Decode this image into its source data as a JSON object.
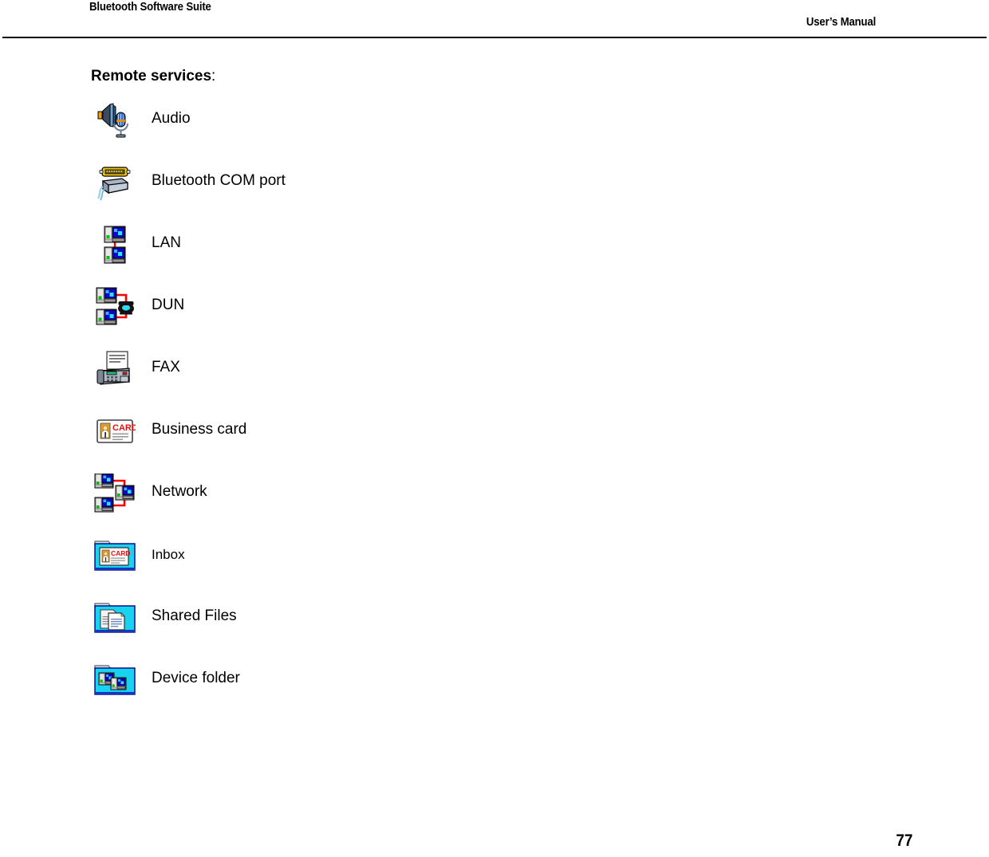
{
  "header": {
    "left_title": "Bluetooth Software Suite",
    "right_title": "User’s Manual"
  },
  "section": {
    "title": "Remote services",
    "title_suffix": ":"
  },
  "services": [
    {
      "icon": "audio-icon",
      "label": "Audio"
    },
    {
      "icon": "serial-port-icon",
      "label": "Bluetooth COM port"
    },
    {
      "icon": "lan-icon",
      "label": "LAN"
    },
    {
      "icon": "dialup-networking-icon",
      "label": "DUN"
    },
    {
      "icon": "fax-machine-icon",
      "label": "FAX"
    },
    {
      "icon": "business-card-icon",
      "label": "Business card"
    },
    {
      "icon": "network-icon",
      "label": "Network"
    },
    {
      "icon": "inbox-folder-icon",
      "label": "Inbox"
    },
    {
      "icon": "shared-files-folder-icon",
      "label": "Shared Files"
    },
    {
      "icon": "device-folder-icon",
      "label": "Device folder"
    }
  ],
  "footer": {
    "page_number": "77"
  },
  "colors": {
    "text": "#000000",
    "rule": "#000000",
    "folder_cyan": "#19D2F0",
    "monitor_blue": "#0808C8",
    "link_red": "#FF0000",
    "card_red": "#E81010",
    "serial_gold": "#F0C814"
  }
}
